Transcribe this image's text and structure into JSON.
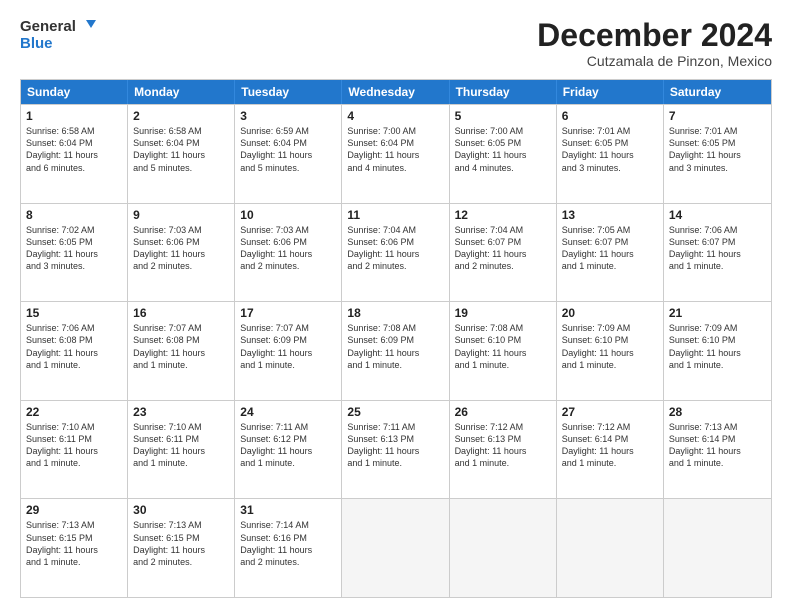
{
  "header": {
    "logo_line1": "General",
    "logo_line2": "Blue",
    "month": "December 2024",
    "location": "Cutzamala de Pinzon, Mexico"
  },
  "days": [
    "Sunday",
    "Monday",
    "Tuesday",
    "Wednesday",
    "Thursday",
    "Friday",
    "Saturday"
  ],
  "weeks": [
    [
      {
        "day": "1",
        "lines": [
          "Sunrise: 6:58 AM",
          "Sunset: 6:04 PM",
          "Daylight: 11 hours",
          "and 6 minutes."
        ]
      },
      {
        "day": "2",
        "lines": [
          "Sunrise: 6:58 AM",
          "Sunset: 6:04 PM",
          "Daylight: 11 hours",
          "and 5 minutes."
        ]
      },
      {
        "day": "3",
        "lines": [
          "Sunrise: 6:59 AM",
          "Sunset: 6:04 PM",
          "Daylight: 11 hours",
          "and 5 minutes."
        ]
      },
      {
        "day": "4",
        "lines": [
          "Sunrise: 7:00 AM",
          "Sunset: 6:04 PM",
          "Daylight: 11 hours",
          "and 4 minutes."
        ]
      },
      {
        "day": "5",
        "lines": [
          "Sunrise: 7:00 AM",
          "Sunset: 6:05 PM",
          "Daylight: 11 hours",
          "and 4 minutes."
        ]
      },
      {
        "day": "6",
        "lines": [
          "Sunrise: 7:01 AM",
          "Sunset: 6:05 PM",
          "Daylight: 11 hours",
          "and 3 minutes."
        ]
      },
      {
        "day": "7",
        "lines": [
          "Sunrise: 7:01 AM",
          "Sunset: 6:05 PM",
          "Daylight: 11 hours",
          "and 3 minutes."
        ]
      }
    ],
    [
      {
        "day": "8",
        "lines": [
          "Sunrise: 7:02 AM",
          "Sunset: 6:05 PM",
          "Daylight: 11 hours",
          "and 3 minutes."
        ]
      },
      {
        "day": "9",
        "lines": [
          "Sunrise: 7:03 AM",
          "Sunset: 6:06 PM",
          "Daylight: 11 hours",
          "and 2 minutes."
        ]
      },
      {
        "day": "10",
        "lines": [
          "Sunrise: 7:03 AM",
          "Sunset: 6:06 PM",
          "Daylight: 11 hours",
          "and 2 minutes."
        ]
      },
      {
        "day": "11",
        "lines": [
          "Sunrise: 7:04 AM",
          "Sunset: 6:06 PM",
          "Daylight: 11 hours",
          "and 2 minutes."
        ]
      },
      {
        "day": "12",
        "lines": [
          "Sunrise: 7:04 AM",
          "Sunset: 6:07 PM",
          "Daylight: 11 hours",
          "and 2 minutes."
        ]
      },
      {
        "day": "13",
        "lines": [
          "Sunrise: 7:05 AM",
          "Sunset: 6:07 PM",
          "Daylight: 11 hours",
          "and 1 minute."
        ]
      },
      {
        "day": "14",
        "lines": [
          "Sunrise: 7:06 AM",
          "Sunset: 6:07 PM",
          "Daylight: 11 hours",
          "and 1 minute."
        ]
      }
    ],
    [
      {
        "day": "15",
        "lines": [
          "Sunrise: 7:06 AM",
          "Sunset: 6:08 PM",
          "Daylight: 11 hours",
          "and 1 minute."
        ]
      },
      {
        "day": "16",
        "lines": [
          "Sunrise: 7:07 AM",
          "Sunset: 6:08 PM",
          "Daylight: 11 hours",
          "and 1 minute."
        ]
      },
      {
        "day": "17",
        "lines": [
          "Sunrise: 7:07 AM",
          "Sunset: 6:09 PM",
          "Daylight: 11 hours",
          "and 1 minute."
        ]
      },
      {
        "day": "18",
        "lines": [
          "Sunrise: 7:08 AM",
          "Sunset: 6:09 PM",
          "Daylight: 11 hours",
          "and 1 minute."
        ]
      },
      {
        "day": "19",
        "lines": [
          "Sunrise: 7:08 AM",
          "Sunset: 6:10 PM",
          "Daylight: 11 hours",
          "and 1 minute."
        ]
      },
      {
        "day": "20",
        "lines": [
          "Sunrise: 7:09 AM",
          "Sunset: 6:10 PM",
          "Daylight: 11 hours",
          "and 1 minute."
        ]
      },
      {
        "day": "21",
        "lines": [
          "Sunrise: 7:09 AM",
          "Sunset: 6:10 PM",
          "Daylight: 11 hours",
          "and 1 minute."
        ]
      }
    ],
    [
      {
        "day": "22",
        "lines": [
          "Sunrise: 7:10 AM",
          "Sunset: 6:11 PM",
          "Daylight: 11 hours",
          "and 1 minute."
        ]
      },
      {
        "day": "23",
        "lines": [
          "Sunrise: 7:10 AM",
          "Sunset: 6:11 PM",
          "Daylight: 11 hours",
          "and 1 minute."
        ]
      },
      {
        "day": "24",
        "lines": [
          "Sunrise: 7:11 AM",
          "Sunset: 6:12 PM",
          "Daylight: 11 hours",
          "and 1 minute."
        ]
      },
      {
        "day": "25",
        "lines": [
          "Sunrise: 7:11 AM",
          "Sunset: 6:13 PM",
          "Daylight: 11 hours",
          "and 1 minute."
        ]
      },
      {
        "day": "26",
        "lines": [
          "Sunrise: 7:12 AM",
          "Sunset: 6:13 PM",
          "Daylight: 11 hours",
          "and 1 minute."
        ]
      },
      {
        "day": "27",
        "lines": [
          "Sunrise: 7:12 AM",
          "Sunset: 6:14 PM",
          "Daylight: 11 hours",
          "and 1 minute."
        ]
      },
      {
        "day": "28",
        "lines": [
          "Sunrise: 7:13 AM",
          "Sunset: 6:14 PM",
          "Daylight: 11 hours",
          "and 1 minute."
        ]
      }
    ],
    [
      {
        "day": "29",
        "lines": [
          "Sunrise: 7:13 AM",
          "Sunset: 6:15 PM",
          "Daylight: 11 hours",
          "and 1 minute."
        ]
      },
      {
        "day": "30",
        "lines": [
          "Sunrise: 7:13 AM",
          "Sunset: 6:15 PM",
          "Daylight: 11 hours",
          "and 2 minutes."
        ]
      },
      {
        "day": "31",
        "lines": [
          "Sunrise: 7:14 AM",
          "Sunset: 6:16 PM",
          "Daylight: 11 hours",
          "and 2 minutes."
        ]
      },
      {
        "day": "",
        "lines": []
      },
      {
        "day": "",
        "lines": []
      },
      {
        "day": "",
        "lines": []
      },
      {
        "day": "",
        "lines": []
      }
    ]
  ]
}
